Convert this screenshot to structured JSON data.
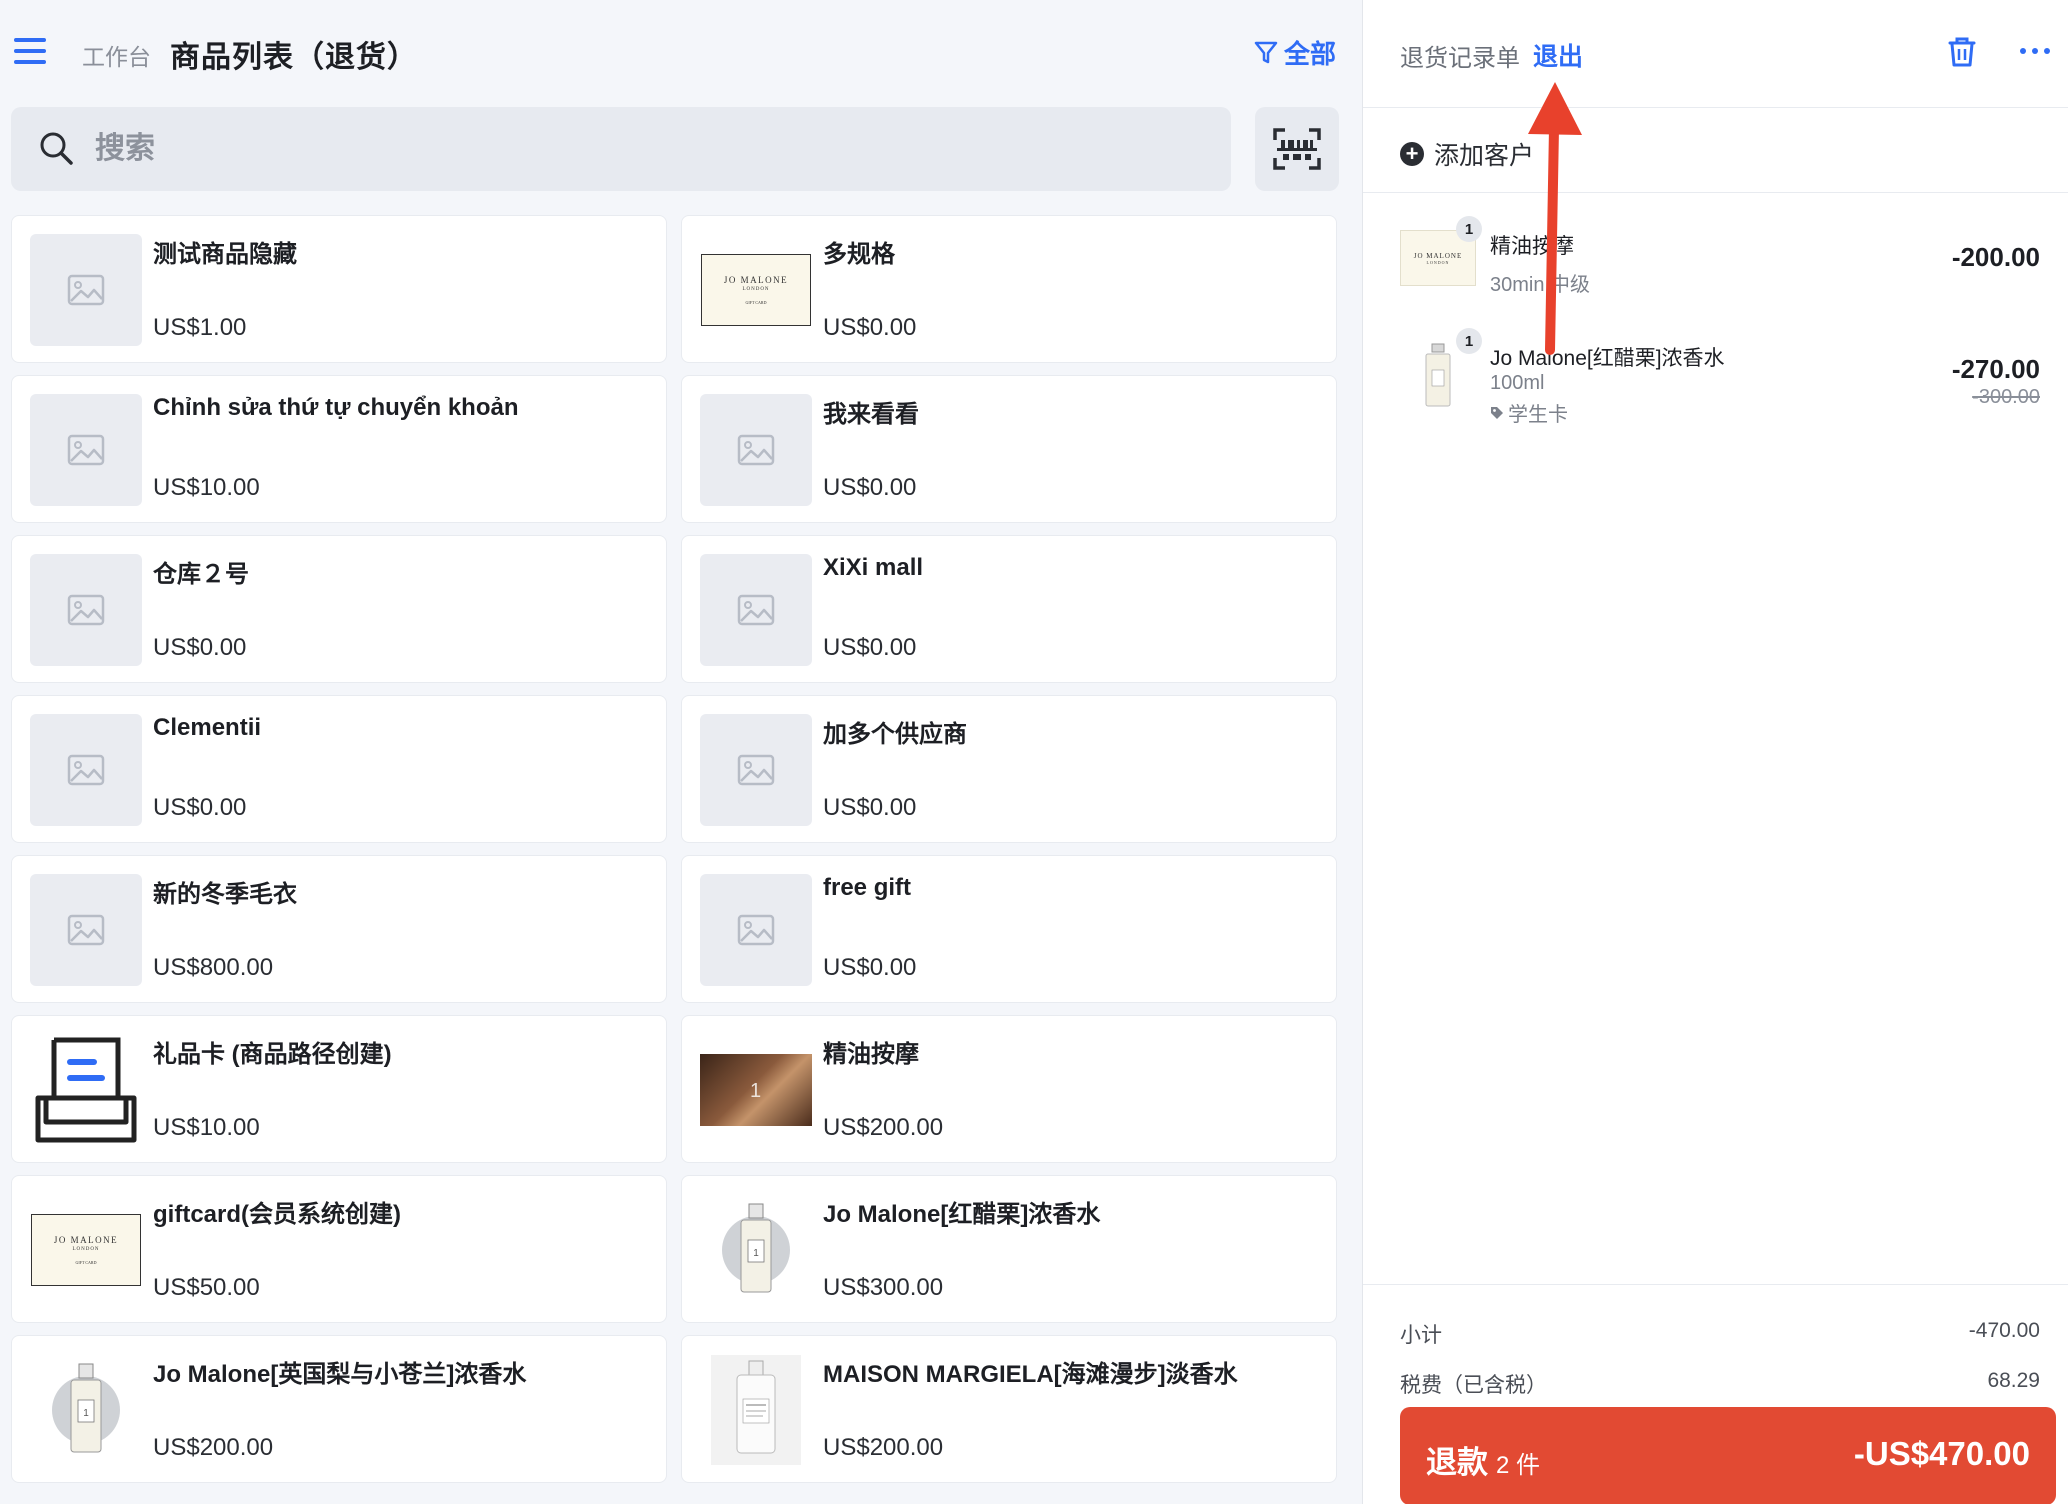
{
  "header": {
    "breadcrumb": "工作台",
    "title": "商品列表（退货）",
    "filter_label": "全部",
    "search_placeholder": "搜索"
  },
  "products": [
    {
      "name": "测试商品隐藏",
      "price": "US$1.00",
      "thumb": "placeholder"
    },
    {
      "name": "多规格",
      "price": "US$0.00",
      "thumb": "jomalone-card"
    },
    {
      "name": "Chỉnh sửa thứ tự chuyển khoản",
      "price": "US$10.00",
      "thumb": "placeholder"
    },
    {
      "name": "我来看看",
      "price": "US$0.00",
      "thumb": "placeholder"
    },
    {
      "name": "仓库２号",
      "price": "US$0.00",
      "thumb": "placeholder"
    },
    {
      "name": "XiXi mall",
      "price": "US$0.00",
      "thumb": "placeholder"
    },
    {
      "name": "Clementii",
      "price": "US$0.00",
      "thumb": "placeholder"
    },
    {
      "name": "加多个供应商",
      "price": "US$0.00",
      "thumb": "placeholder"
    },
    {
      "name": "新的冬季毛衣",
      "price": "US$800.00",
      "thumb": "placeholder"
    },
    {
      "name": "free gift",
      "price": "US$0.00",
      "thumb": "placeholder"
    },
    {
      "name": "礼品卡 (商品路径创建)",
      "price": "US$10.00",
      "thumb": "giftcard-icon"
    },
    {
      "name": "精油按摩",
      "price": "US$200.00",
      "thumb": "massage-photo"
    },
    {
      "name": "giftcard(会员系统创建)",
      "price": "US$50.00",
      "thumb": "jomalone-card"
    },
    {
      "name": "Jo Malone[红醋栗]浓香水",
      "price": "US$300.00",
      "thumb": "perfume-bottle"
    },
    {
      "name": "Jo Malone[英国梨与小苍兰]浓香水",
      "price": "US$200.00",
      "thumb": "perfume-bottle"
    },
    {
      "name": "MAISON MARGIELA[海滩漫步]淡香水",
      "price": "US$200.00",
      "thumb": "margiela-bottle"
    }
  ],
  "thumb_text": {
    "jomalone_brand": "JO MALONE",
    "jomalone_city": "LONDON",
    "jomalone_sub": "GIFT CARD",
    "massage_qty": "1",
    "perfume_qty": "1"
  },
  "cart": {
    "title": "退货记录单",
    "exit_label": "退出",
    "add_customer": "添加客户",
    "lines": [
      {
        "qty": "1",
        "name": "精油按摩",
        "sub1": "30min 中级",
        "amount": "-200.00"
      },
      {
        "qty": "1",
        "name": "Jo Malone[红醋栗]浓香水",
        "sub1": "100ml",
        "sub2": "学生卡",
        "amount": "-270.00",
        "original": "-300.00"
      }
    ],
    "subtotal_label": "小计",
    "subtotal_value": "-470.00",
    "tax_label": "税费（已含税）",
    "tax_value": "68.29",
    "refund_label": "退款",
    "refund_count": "2 件",
    "refund_amount": "-US$470.00"
  },
  "colors": {
    "accent": "#2f6cf5",
    "refund": "#e24a33",
    "annotation_arrow": "#e8412c"
  }
}
